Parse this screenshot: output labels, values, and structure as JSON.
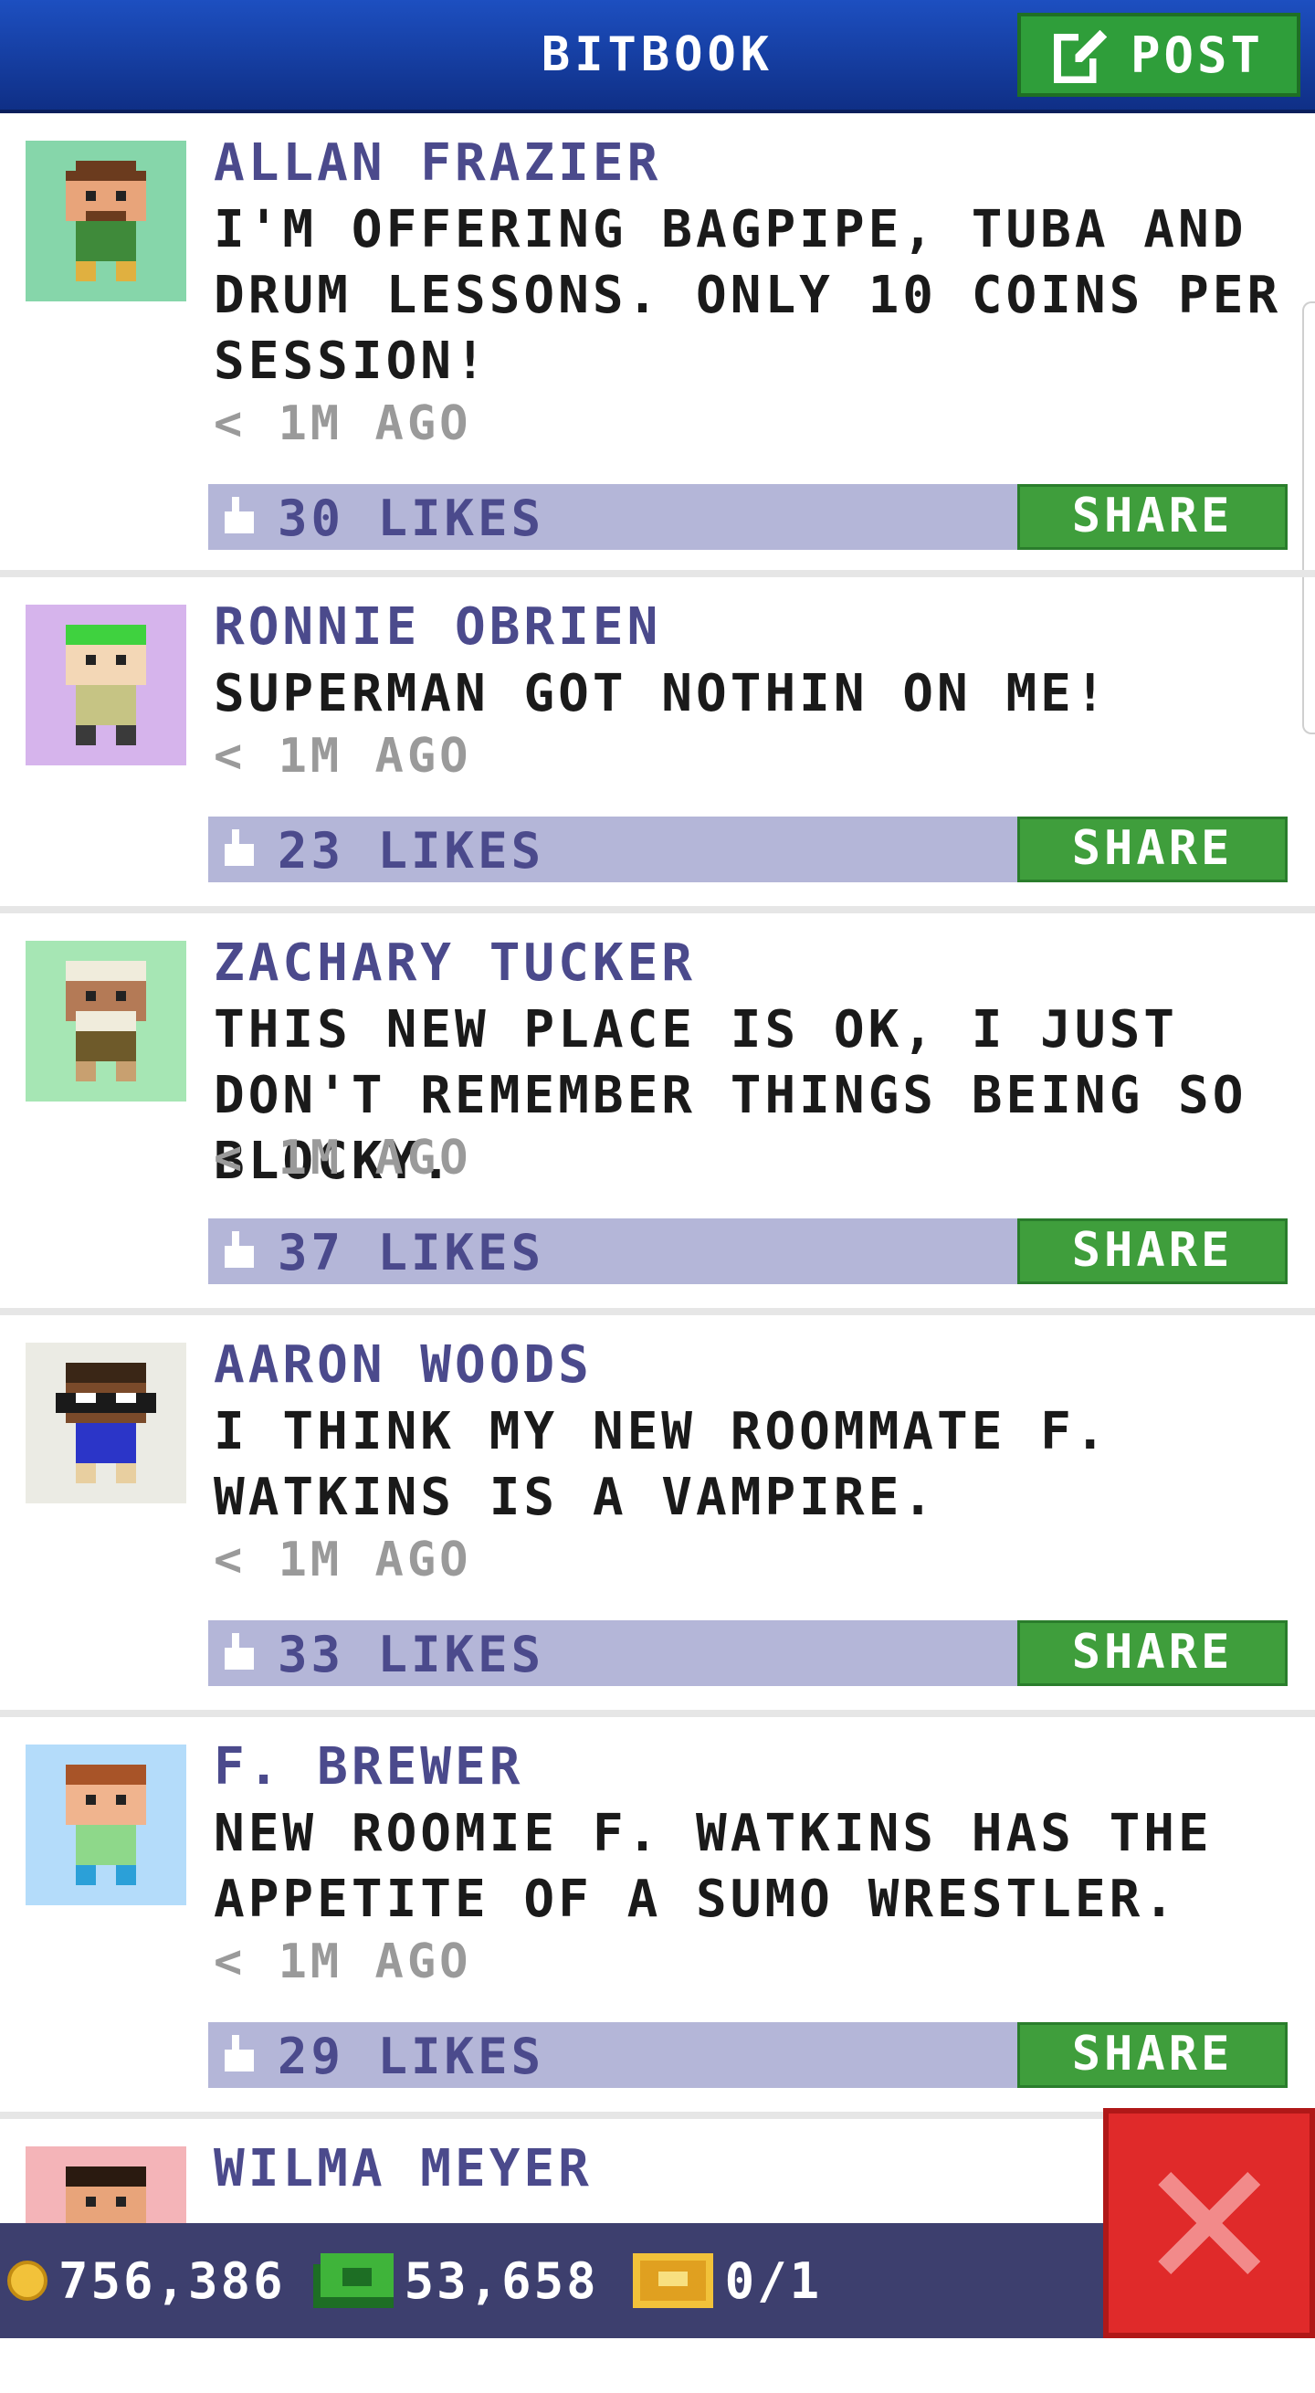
{
  "header": {
    "title": "BITBOOK",
    "post_label": "POST"
  },
  "posts": [
    {
      "author": "ALLAN FRAZIER",
      "text": "I'M OFFERING BAGPIPE, TUBA AND DRUM LESSONS. ONLY 10 COINS PER SESSION!",
      "time": "< 1M AGO",
      "likes": "30 LIKES",
      "share_label": "SHARE",
      "avatar_bg": "#86d6aa"
    },
    {
      "author": "RONNIE OBRIEN",
      "text": "SUPERMAN GOT NOTHIN ON ME!",
      "time": "< 1M AGO",
      "likes": "23 LIKES",
      "share_label": "SHARE",
      "avatar_bg": "#d6b4ec"
    },
    {
      "author": "ZACHARY TUCKER",
      "text": "THIS NEW PLACE IS OK, I JUST DON'T REMEMBER THINGS BEING SO BLOCKY.",
      "time": "< 1M AGO",
      "likes": "37 LIKES",
      "share_label": "SHARE",
      "avatar_bg": "#a6e6b4"
    },
    {
      "author": "AARON WOODS",
      "text": "I THINK MY NEW ROOMMATE F. WATKINS IS A VAMPIRE.",
      "time": "< 1M AGO",
      "likes": "33 LIKES",
      "share_label": "SHARE",
      "avatar_bg": "#ebebe4"
    },
    {
      "author": "F. BREWER",
      "text": "NEW ROOMIE F. WATKINS HAS THE APPETITE OF A SUMO WRESTLER.",
      "time": "< 1M AGO",
      "likes": "29 LIKES",
      "share_label": "SHARE",
      "avatar_bg": "#b4dcfa"
    },
    {
      "author": "WILMA MEYER",
      "avatar_bg": "#f4b4b8"
    }
  ],
  "footer": {
    "coins": "756,386",
    "bux": "53,658",
    "tickets": "0/1"
  },
  "colors": {
    "header_blue": "#1d4fc0",
    "accent_green": "#3f9e3c",
    "likes_bar": "#b4b6d8",
    "author_purple": "#4b4a8c",
    "close_red": "#e02a2a",
    "footer_bg": "#3d3f6e"
  }
}
